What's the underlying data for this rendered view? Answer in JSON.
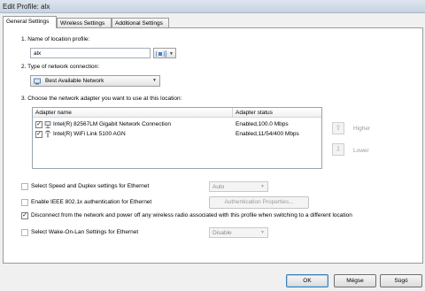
{
  "window": {
    "title": "Edit Profile: alx"
  },
  "tabs": [
    "General Settings",
    "Wireless Settings",
    "Additional Settings"
  ],
  "sections": {
    "name_label": "1. Name of location profile:",
    "name_value": "alx",
    "type_label": "2. Type of network connection:",
    "type_value": "Best Available Network",
    "adapter_label": "3. Choose the network adapter you want to use at this location:"
  },
  "adapter_table": {
    "columns": [
      "Adapter name",
      "Adapter status"
    ],
    "rows": [
      {
        "name": "Intel(R) 82567LM Gigabit Network Connection",
        "status": "Enabled,100.0 Mbps",
        "checked": true
      },
      {
        "name": "Intel(R) WiFi Link 5100 AGN",
        "status": "Enabled,11/54/400  Mbps",
        "checked": true
      }
    ]
  },
  "side_buttons": {
    "higher": "Higher",
    "lower": "Lower"
  },
  "options": {
    "speed_duplex": {
      "label": "Select Speed and Duplex settings for Ethernet",
      "checked": false,
      "value": "Auto"
    },
    "ieee8021x": {
      "label": "Enable IEEE 802.1x authentication for Ethernet",
      "checked": false,
      "button": "Authentication Properties..."
    },
    "disconnect": {
      "label": "Disconnect from the network and power off any wireless radio associated with this profile when switching to a different location",
      "checked": true
    },
    "wol": {
      "label": "Select Wake-On-Lan Settings for Ethernet",
      "checked": false,
      "value": "Disable"
    }
  },
  "footer": {
    "ok": "OK",
    "cancel": "Mégse",
    "help": "Súgó"
  },
  "icons": {
    "profile_icon": "network-profile-icon",
    "connection_icon": "network-connection-icon",
    "up_icon": "arrow-up-icon",
    "down_icon": "arrow-down-icon",
    "wired_icon": "wired-adapter-icon",
    "wireless_icon": "wireless-adapter-icon"
  },
  "colors": {
    "accent": "#3c7fb1",
    "window_bg": "#f0f0f0",
    "panel_bg": "#ffffff"
  }
}
